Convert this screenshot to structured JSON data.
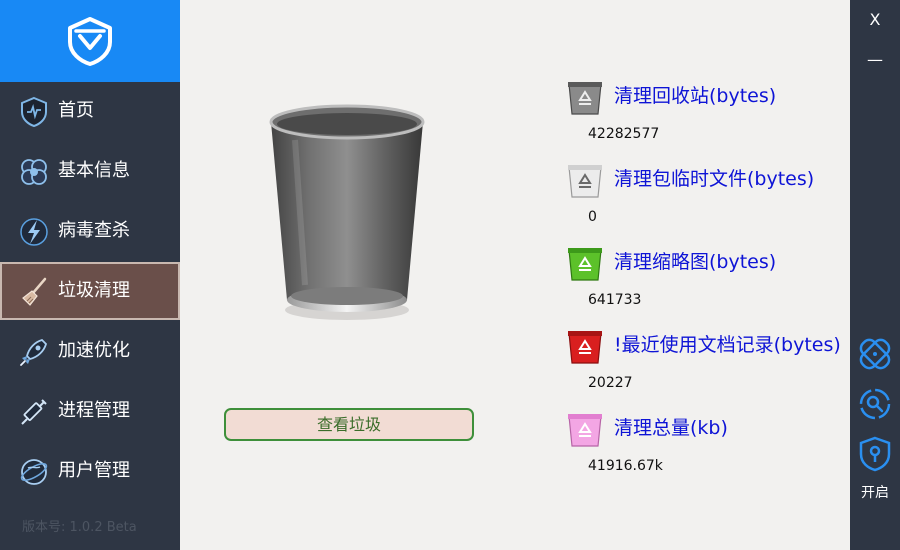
{
  "app": {
    "version": "版本号: 1.0.2  Beta"
  },
  "sidebar": {
    "items": [
      {
        "label": "首页",
        "icon": "home-shield-icon"
      },
      {
        "label": "基本信息",
        "icon": "clover-info-icon"
      },
      {
        "label": "病毒查杀",
        "icon": "lightning-virus-icon"
      },
      {
        "label": "垃圾清理",
        "icon": "broom-icon",
        "active": true
      },
      {
        "label": "加速优化",
        "icon": "rocket-icon"
      },
      {
        "label": "进程管理",
        "icon": "syringe-icon"
      },
      {
        "label": "用户管理",
        "icon": "globe-user-icon"
      }
    ]
  },
  "main": {
    "view_button": "查看垃圾",
    "stats": [
      {
        "label": "清理回收站(bytes)",
        "value": "42282577",
        "icon": "recycle-bin-gray-icon",
        "color": "#8a8a8a"
      },
      {
        "label": "清理包临时文件(bytes)",
        "value": "0",
        "icon": "recycle-bin-white-icon",
        "color": "#e6e6e6"
      },
      {
        "label": "清理缩略图(bytes)",
        "value": "641733",
        "icon": "recycle-bin-green-icon",
        "color": "#5cc12a"
      },
      {
        "label": "!最近使用文档记录(bytes)",
        "value": "20227",
        "icon": "recycle-bin-red-icon",
        "color": "#d91f1f"
      },
      {
        "label": "清理总量(kb)",
        "value": "41916.67k",
        "icon": "recycle-bin-pink-icon",
        "color": "#f3a6e4"
      }
    ]
  },
  "rightbar": {
    "close": "X",
    "minimize": "—",
    "open_label": "开启"
  },
  "colors": {
    "sidebar_bg": "#2e3644",
    "logo_bg": "#1889f5",
    "active_bg": "#6a4f4a",
    "stat_text": "#0e14d6",
    "tool_icon": "#2a8ff0"
  }
}
